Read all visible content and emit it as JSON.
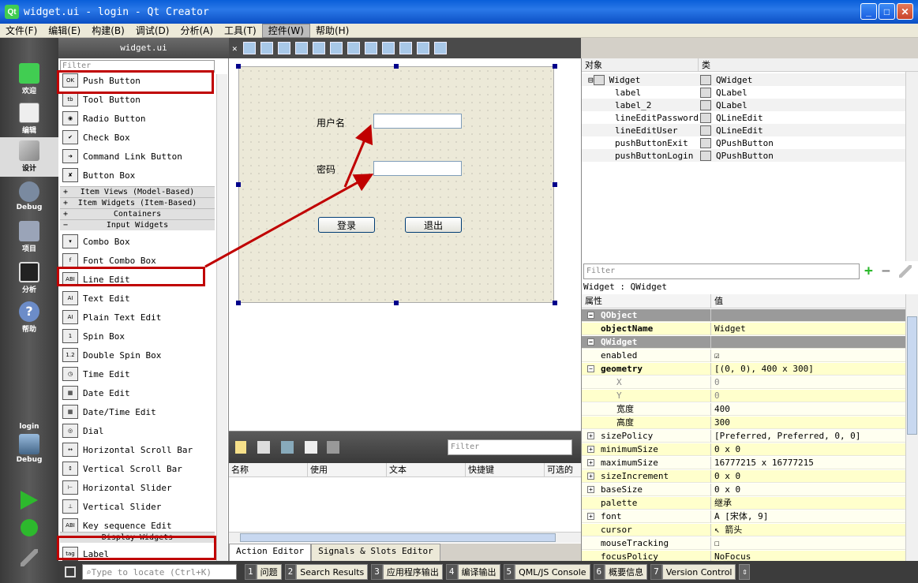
{
  "window": {
    "title": "widget.ui - login - Qt Creator",
    "app_icon": "Qt"
  },
  "menu": [
    "文件(F)",
    "编辑(E)",
    "构建(B)",
    "调试(D)",
    "分析(A)",
    "工具(T)",
    "控件(W)",
    "帮助(H)"
  ],
  "modes": [
    {
      "label": "欢迎",
      "icon": "qt-welcome-icon"
    },
    {
      "label": "编辑",
      "icon": "edit-document-icon"
    },
    {
      "label": "设计",
      "icon": "design-pencil-icon"
    },
    {
      "label": "Debug",
      "icon": "debug-icon"
    },
    {
      "label": "项目",
      "icon": "project-icon"
    },
    {
      "label": "分析",
      "icon": "analyze-icon"
    },
    {
      "label": "帮助",
      "icon": "help-icon"
    }
  ],
  "target": {
    "project": "login",
    "mode": "Debug"
  },
  "widgetbox": {
    "file_tab": "widget.ui",
    "filter_placeholder": "Filter",
    "items_top": [
      {
        "label": "Push Button",
        "icon": "OK"
      },
      {
        "label": "Tool Button",
        "icon": "tb"
      },
      {
        "label": "Radio Button",
        "icon": "◉"
      },
      {
        "label": "Check Box",
        "icon": "✔"
      },
      {
        "label": "Command Link Button",
        "icon": "➜"
      },
      {
        "label": "Button Box",
        "icon": "✘"
      }
    ],
    "categories": [
      "Item Views (Model-Based)",
      "Item Widgets (Item-Based)",
      "Containers",
      "Input Widgets"
    ],
    "items_input": [
      {
        "label": "Combo Box",
        "icon": "▾"
      },
      {
        "label": "Font Combo Box",
        "icon": "f"
      },
      {
        "label": "Line Edit",
        "icon": "ABI"
      },
      {
        "label": "Text Edit",
        "icon": "AI"
      },
      {
        "label": "Plain Text Edit",
        "icon": "AI"
      },
      {
        "label": "Spin Box",
        "icon": "1"
      },
      {
        "label": "Double Spin Box",
        "icon": "1.2"
      },
      {
        "label": "Time Edit",
        "icon": "◷"
      },
      {
        "label": "Date Edit",
        "icon": "▦"
      },
      {
        "label": "Date/Time Edit",
        "icon": "▦"
      },
      {
        "label": "Dial",
        "icon": "◎"
      },
      {
        "label": "Horizontal Scroll Bar",
        "icon": "↔"
      },
      {
        "label": "Vertical Scroll Bar",
        "icon": "↕"
      },
      {
        "label": "Horizontal Slider",
        "icon": "⊢"
      },
      {
        "label": "Vertical Slider",
        "icon": "⊥"
      },
      {
        "label": "Key sequence Edit",
        "icon": "ABI"
      }
    ],
    "display_category": "Display Widgets",
    "label_item": {
      "label": "Label",
      "icon": "tag"
    }
  },
  "form": {
    "label_user": "用户名",
    "label_pass": "密码",
    "btn_login": "登录",
    "btn_exit": "退出"
  },
  "action_editor": {
    "filter_placeholder": "Filter",
    "columns": [
      "名称",
      "使用",
      "文本",
      "快捷键",
      "可选的"
    ],
    "tabs": [
      "Action Editor",
      "Signals & Slots Editor"
    ]
  },
  "object_inspector": {
    "headers": [
      "对象",
      "类"
    ],
    "rows": [
      {
        "obj": "Widget",
        "cls": "QWidget"
      },
      {
        "obj": "label",
        "cls": "QLabel"
      },
      {
        "obj": "label_2",
        "cls": "QLabel"
      },
      {
        "obj": "lineEditPassword",
        "cls": "QLineEdit"
      },
      {
        "obj": "lineEditUser",
        "cls": "QLineEdit"
      },
      {
        "obj": "pushButtonExit",
        "cls": "QPushButton"
      },
      {
        "obj": "pushButtonLogin",
        "cls": "QPushButton"
      }
    ]
  },
  "property_editor": {
    "filter_placeholder": "Filter",
    "context": "Widget : QWidget",
    "headers": [
      "属性",
      "值"
    ],
    "rows": [
      {
        "k": "QObject",
        "v": "",
        "type": "sec"
      },
      {
        "k": "objectName",
        "v": "Widget",
        "type": "yel",
        "bold": true
      },
      {
        "k": "QWidget",
        "v": "",
        "type": "sec"
      },
      {
        "k": "enabled",
        "v": "☑",
        "type": "alt"
      },
      {
        "k": "geometry",
        "v": "[(0, 0), 400 x 300]",
        "type": "yel",
        "bold": true
      },
      {
        "k": "X",
        "v": "0",
        "type": "alt",
        "grey": true
      },
      {
        "k": "Y",
        "v": "0",
        "type": "yel",
        "grey": true
      },
      {
        "k": "宽度",
        "v": "400",
        "type": "alt"
      },
      {
        "k": "高度",
        "v": "300",
        "type": "yel"
      },
      {
        "k": "sizePolicy",
        "v": "[Preferred, Preferred, 0, 0]",
        "type": "alt"
      },
      {
        "k": "minimumSize",
        "v": "0 x 0",
        "type": "yel"
      },
      {
        "k": "maximumSize",
        "v": "16777215 x 16777215",
        "type": "alt"
      },
      {
        "k": "sizeIncrement",
        "v": "0 x 0",
        "type": "yel"
      },
      {
        "k": "baseSize",
        "v": "0 x 0",
        "type": "alt"
      },
      {
        "k": "palette",
        "v": "继承",
        "type": "yel"
      },
      {
        "k": "font",
        "v": "A  [宋体, 9]",
        "type": "alt"
      },
      {
        "k": "cursor",
        "v": "↖  箭头",
        "type": "yel"
      },
      {
        "k": "mouseTracking",
        "v": "☐",
        "type": "alt"
      },
      {
        "k": "focusPolicy",
        "v": "NoFocus",
        "type": "yel"
      }
    ]
  },
  "statusbar": {
    "locate_placeholder": "Type to locate (Ctrl+K)",
    "panes": [
      {
        "n": "1",
        "l": "问题"
      },
      {
        "n": "2",
        "l": "Search Results"
      },
      {
        "n": "3",
        "l": "应用程序输出"
      },
      {
        "n": "4",
        "l": "编译输出"
      },
      {
        "n": "5",
        "l": "QML/JS Console"
      },
      {
        "n": "6",
        "l": "概要信息"
      },
      {
        "n": "7",
        "l": "Version Control"
      }
    ]
  },
  "colors": {
    "annotation": "#c00000",
    "selection": "#00008b"
  }
}
